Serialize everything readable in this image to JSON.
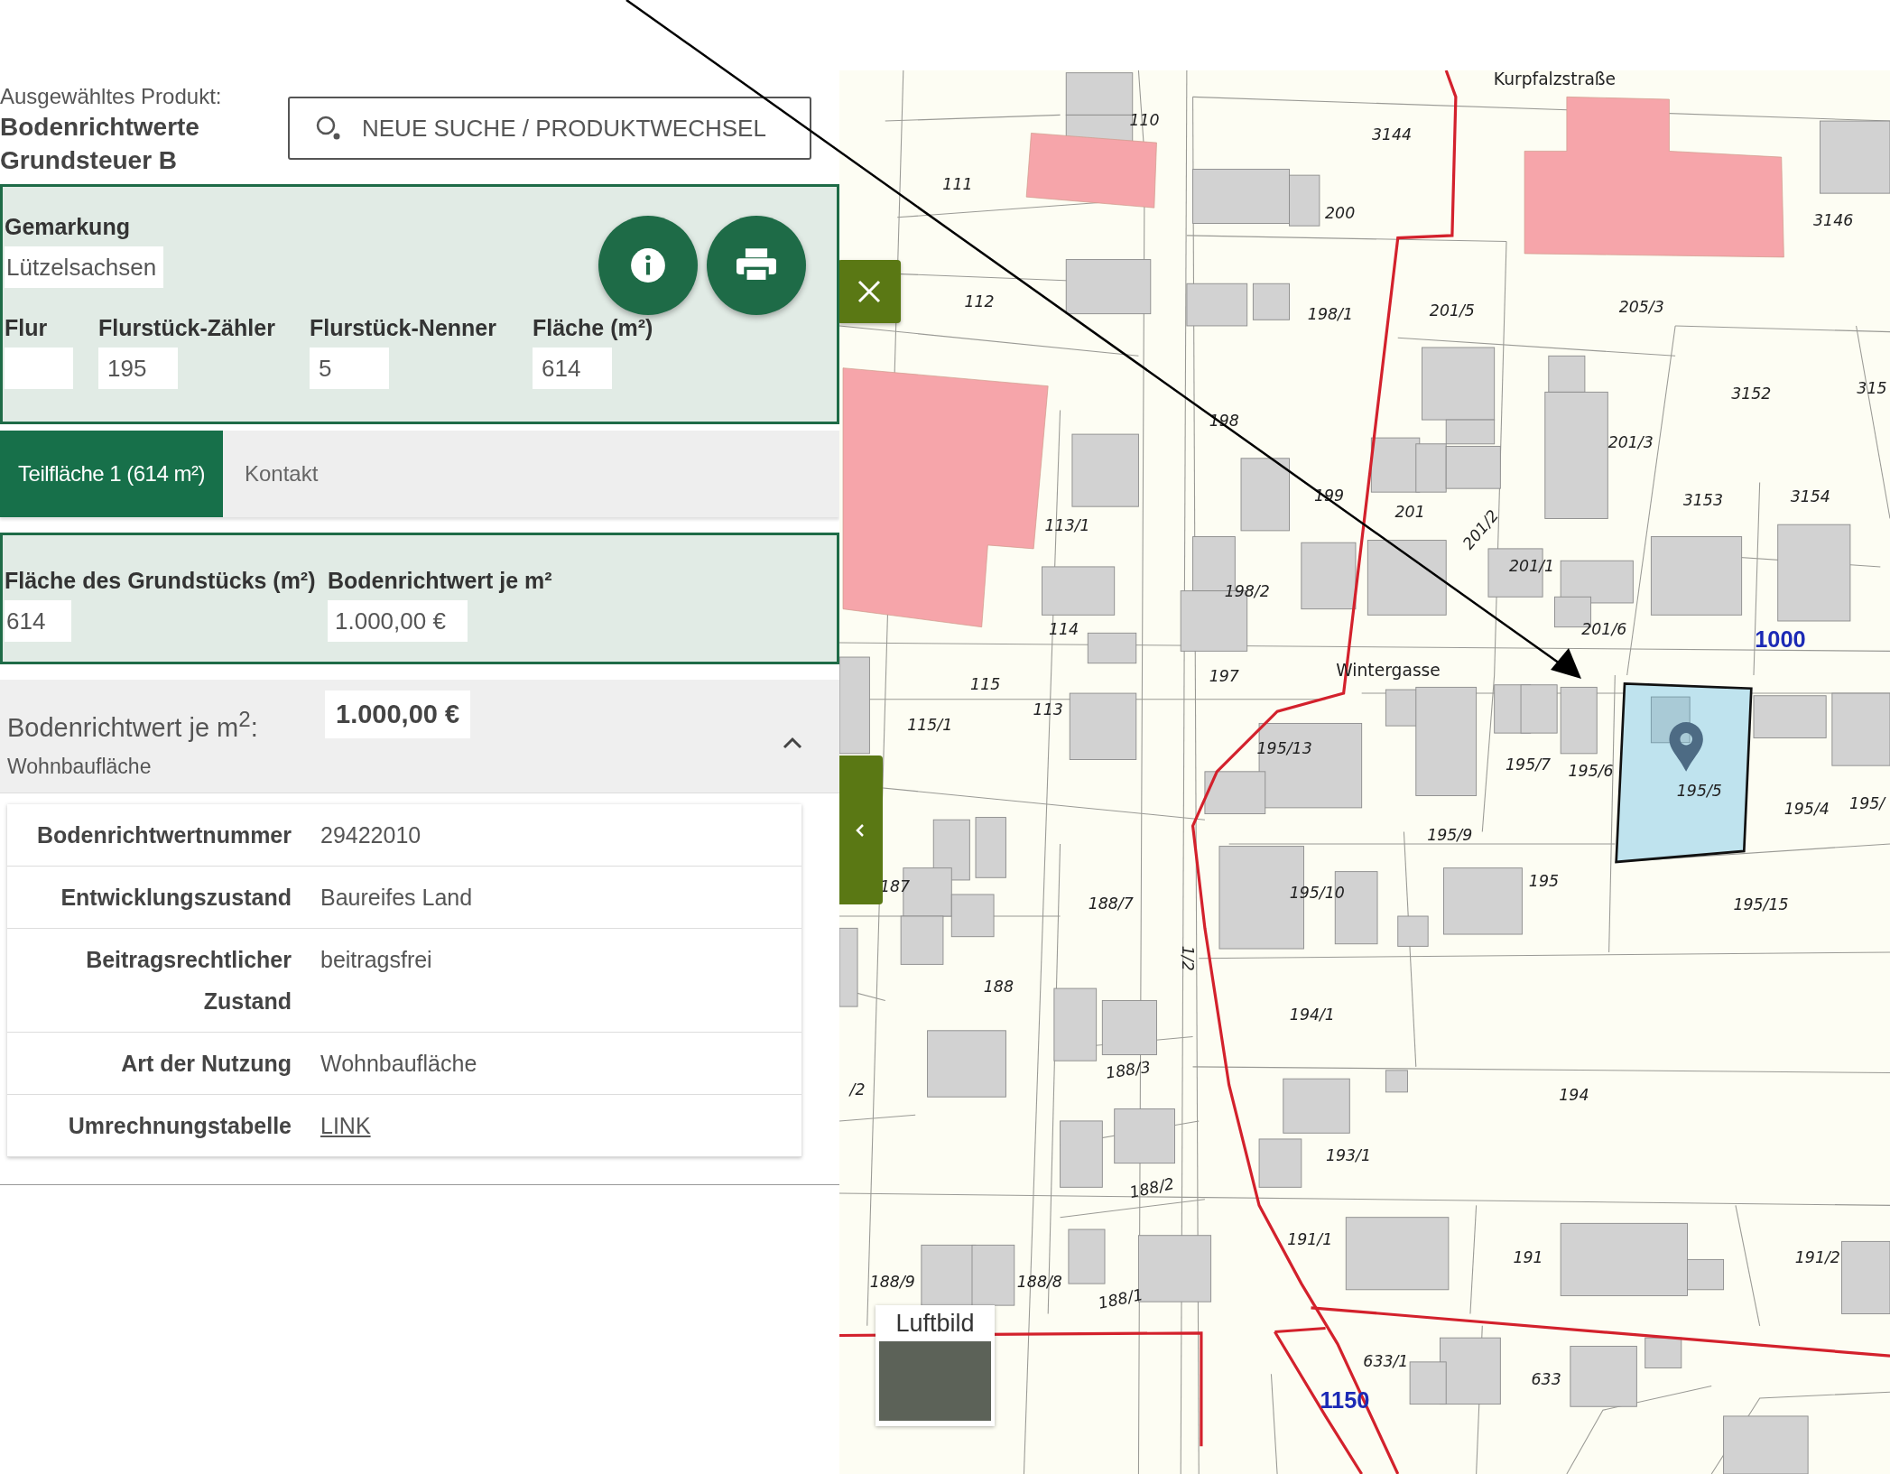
{
  "product": {
    "label": "Ausgewähltes Produkt:",
    "name": "Bodenrichtwerte Grundsteuer B"
  },
  "search_button": {
    "label": "NEUE SUCHE / PRODUKTWECHSEL"
  },
  "parcel_form": {
    "gemarkung": {
      "label": "Gemarkung",
      "value": "Lützelsachsen"
    },
    "fields": [
      {
        "label": "Flur"
      },
      {
        "label": "Flurstück-Zähler",
        "value": "195"
      },
      {
        "label": "Flurstück-Nenner",
        "value": "5"
      },
      {
        "label": "Fläche (m²)",
        "value": "614"
      }
    ]
  },
  "tabs": [
    {
      "label": "Teilfläche 1 (614 m²)",
      "selected": true
    },
    {
      "label": "Kontakt",
      "selected": false
    }
  ],
  "area_card": {
    "fields": [
      {
        "label": "Fläche des Grundstücks (m²)",
        "value": "614"
      },
      {
        "label": "Bodenrichtwert je m²",
        "value": "1.000,00 €"
      }
    ]
  },
  "accordion": {
    "title": "Bodenrichtwert je m$^{2}$:",
    "subtitle": "Wohnbaufläche",
    "value": "1.000,00 €",
    "expanded": true,
    "rows": [
      {
        "label": "Bodenrichtwertnummer",
        "value": "29422010",
        "kind": "text"
      },
      {
        "label": "Entwicklungszustand",
        "value": "Baureifes Land",
        "kind": "text"
      },
      {
        "label": "Beitragsrechtlicher Zustand",
        "value": "beitragsfrei",
        "kind": "text"
      },
      {
        "label": "Art der Nutzung",
        "value": "Wohnbaufläche",
        "kind": "text"
      },
      {
        "label": "Umrechnungstabelle",
        "value": "LINK",
        "kind": "link"
      }
    ]
  },
  "map": {
    "labels": [
      {
        "text": "Kurpfalzstraße",
        "kind": "street"
      },
      {
        "text": "3144",
        "kind": "parcel"
      },
      {
        "text": "110",
        "kind": "parcel"
      },
      {
        "text": "111",
        "kind": "parcel"
      },
      {
        "text": "200",
        "kind": "parcel"
      },
      {
        "text": "3146",
        "kind": "parcel"
      },
      {
        "text": "112",
        "kind": "parcel"
      },
      {
        "text": "198/1",
        "kind": "parcel"
      },
      {
        "text": "201/5",
        "kind": "parcel"
      },
      {
        "text": "205/3",
        "kind": "parcel"
      },
      {
        "text": "3152",
        "kind": "parcel"
      },
      {
        "text": "315",
        "kind": "parcel"
      },
      {
        "text": "198",
        "kind": "parcel"
      },
      {
        "text": "201/3",
        "kind": "parcel"
      },
      {
        "text": "199",
        "kind": "parcel"
      },
      {
        "text": "201",
        "kind": "parcel"
      },
      {
        "text": "201/2",
        "kind": "parcel"
      },
      {
        "text": "3153",
        "kind": "parcel"
      },
      {
        "text": "3154",
        "kind": "parcel"
      },
      {
        "text": "113/1",
        "kind": "parcel"
      },
      {
        "text": "201/1",
        "kind": "parcel"
      },
      {
        "text": "198/2",
        "kind": "parcel"
      },
      {
        "text": "201/6",
        "kind": "parcel"
      },
      {
        "text": "1000",
        "kind": "zone"
      },
      {
        "text": "114",
        "kind": "parcel"
      },
      {
        "text": "197",
        "kind": "parcel"
      },
      {
        "text": "Wintergasse",
        "kind": "street"
      },
      {
        "text": "115",
        "kind": "parcel"
      },
      {
        "text": "113",
        "kind": "parcel"
      },
      {
        "text": "115/1",
        "kind": "parcel"
      },
      {
        "text": "195/13",
        "kind": "parcel"
      },
      {
        "text": "195/7",
        "kind": "parcel"
      },
      {
        "text": "195/6",
        "kind": "parcel"
      },
      {
        "text": "195/5",
        "kind": "parcel"
      },
      {
        "text": "195/4",
        "kind": "parcel"
      },
      {
        "text": "195/",
        "kind": "parcel"
      },
      {
        "text": "195/9",
        "kind": "parcel"
      },
      {
        "text": "187",
        "kind": "parcel"
      },
      {
        "text": "188/7",
        "kind": "parcel"
      },
      {
        "text": "195/10",
        "kind": "parcel"
      },
      {
        "text": "195",
        "kind": "parcel"
      },
      {
        "text": "195/15",
        "kind": "parcel"
      },
      {
        "text": "1/2",
        "kind": "parcel"
      },
      {
        "text": "188",
        "kind": "parcel"
      },
      {
        "text": "194/1",
        "kind": "parcel"
      },
      {
        "text": "188/3",
        "kind": "parcel"
      },
      {
        "text": "/2",
        "kind": "parcel"
      },
      {
        "text": "194",
        "kind": "parcel"
      },
      {
        "text": "193/1",
        "kind": "parcel"
      },
      {
        "text": "188/2",
        "kind": "parcel"
      },
      {
        "text": "191/1",
        "kind": "parcel"
      },
      {
        "text": "191",
        "kind": "parcel"
      },
      {
        "text": "191/2",
        "kind": "parcel"
      },
      {
        "text": "188/9",
        "kind": "parcel"
      },
      {
        "text": "188/8",
        "kind": "parcel"
      },
      {
        "text": "188/1",
        "kind": "parcel"
      },
      {
        "text": "633/1",
        "kind": "parcel"
      },
      {
        "text": "633",
        "kind": "parcel"
      },
      {
        "text": "1150",
        "kind": "zone"
      }
    ],
    "layer_switch": {
      "label": "Luftbild",
      "selected": false
    }
  }
}
